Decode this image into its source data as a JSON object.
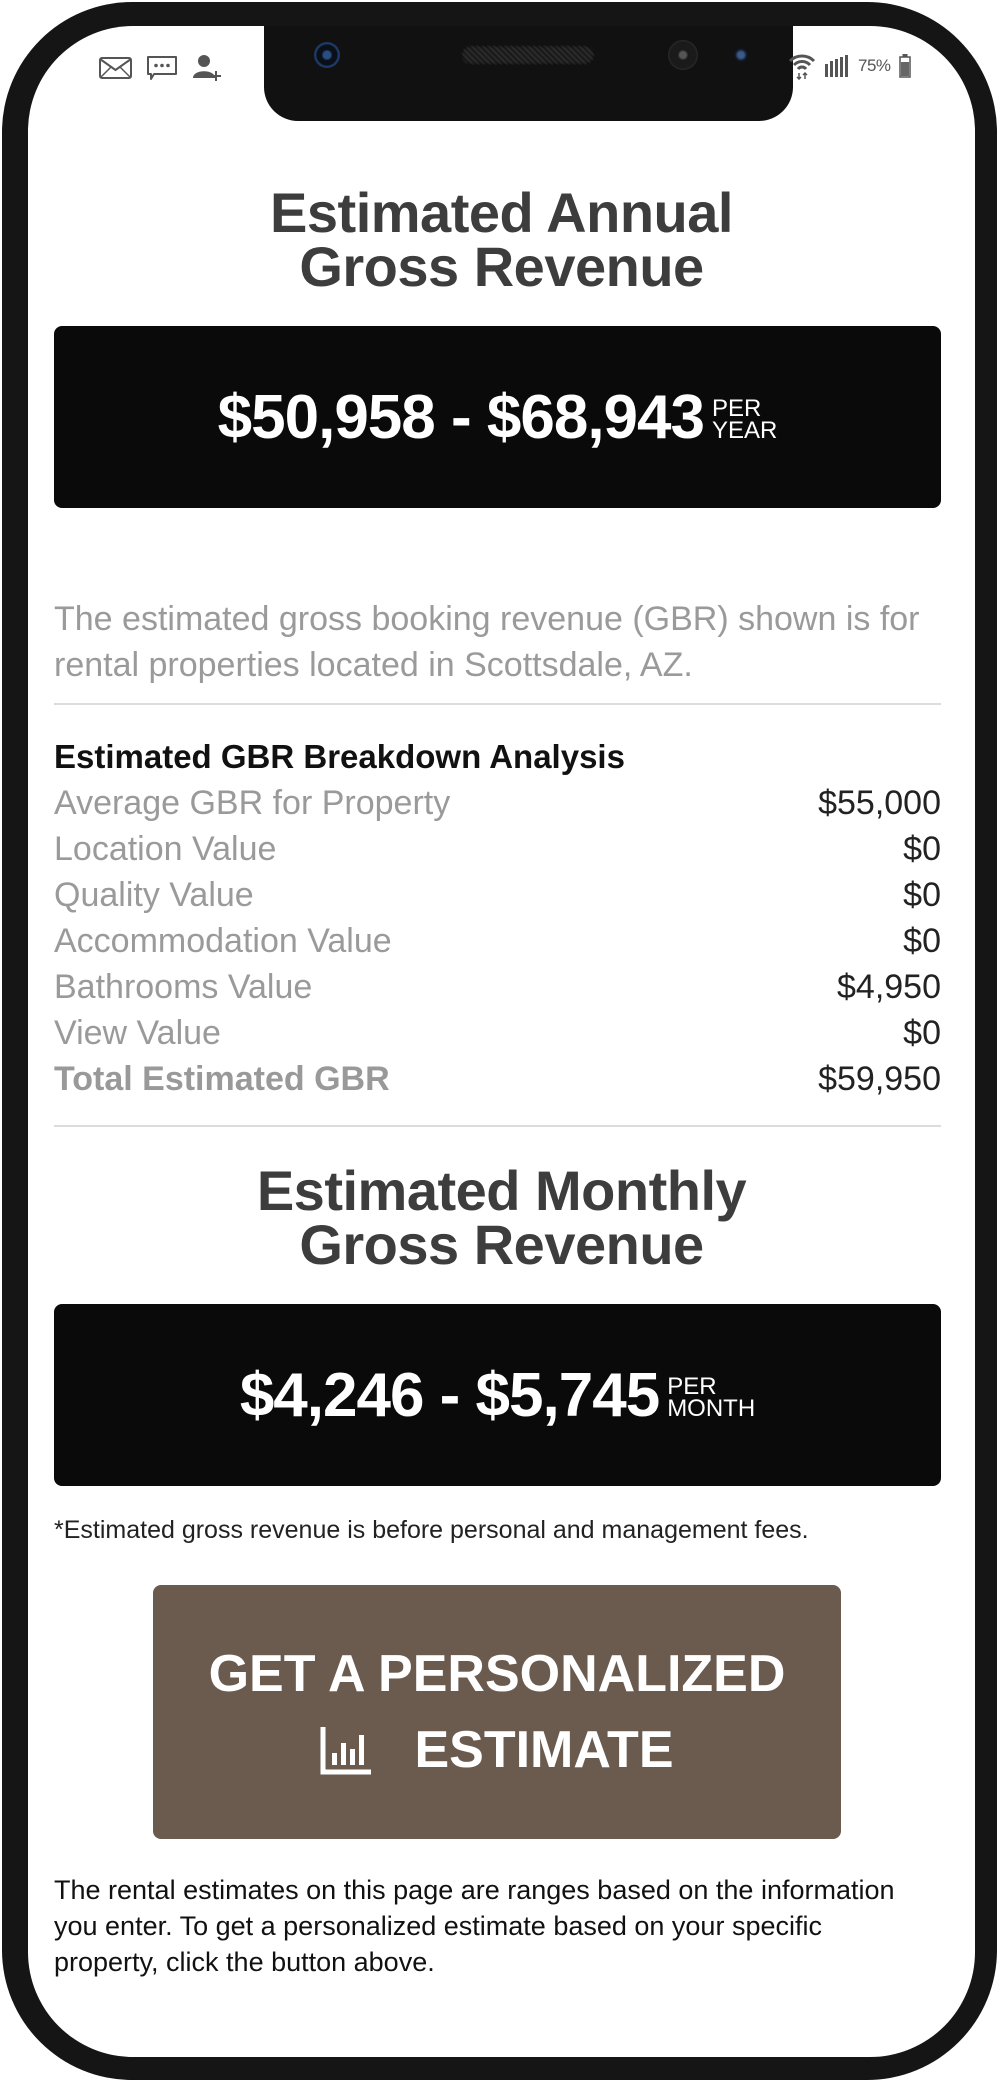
{
  "status_bar": {
    "left_icons": [
      "mail-icon",
      "chat-icon",
      "add-contact-icon"
    ],
    "right_icons": [
      "wifi-icon",
      "signal-icon",
      "battery-icon"
    ],
    "battery_percent": "75%"
  },
  "annual": {
    "title_line1": "Estimated Annual",
    "title_line2": "Gross Revenue",
    "range": "$50,958 - $68,943",
    "unit_line1": "PER",
    "unit_line2": "YEAR"
  },
  "description": "The estimated gross booking revenue (GBR) shown is for rental properties located in Scottsdale, AZ.",
  "breakdown": {
    "heading": "Estimated GBR Breakdown Analysis",
    "rows": [
      {
        "label": "Average GBR for Property",
        "value": "$55,000"
      },
      {
        "label": "Location Value",
        "value": "$0"
      },
      {
        "label": "Quality Value",
        "value": "$0"
      },
      {
        "label": "Accommodation Value",
        "value": "$0"
      },
      {
        "label": "Bathrooms Value",
        "value": "$4,950"
      },
      {
        "label": "View Value",
        "value": "$0"
      },
      {
        "label": "Total Estimated GBR",
        "value": "$59,950"
      }
    ]
  },
  "monthly": {
    "title_line1": "Estimated Monthly",
    "title_line2": "Gross Revenue",
    "range": "$4,246 - $5,745",
    "unit_line1": "PER",
    "unit_line2": "MONTH"
  },
  "footnote": "*Estimated gross revenue is before personal and management fees.",
  "cta": {
    "line1": "GET A PERSONALIZED",
    "line2": "ESTIMATE",
    "icon": "bar-chart-icon",
    "color": "#6b5b4f"
  },
  "footer_text": "The rental estimates on this page are ranges based on the information you enter. To get a personalized estimate based on your specific property, click the button above."
}
